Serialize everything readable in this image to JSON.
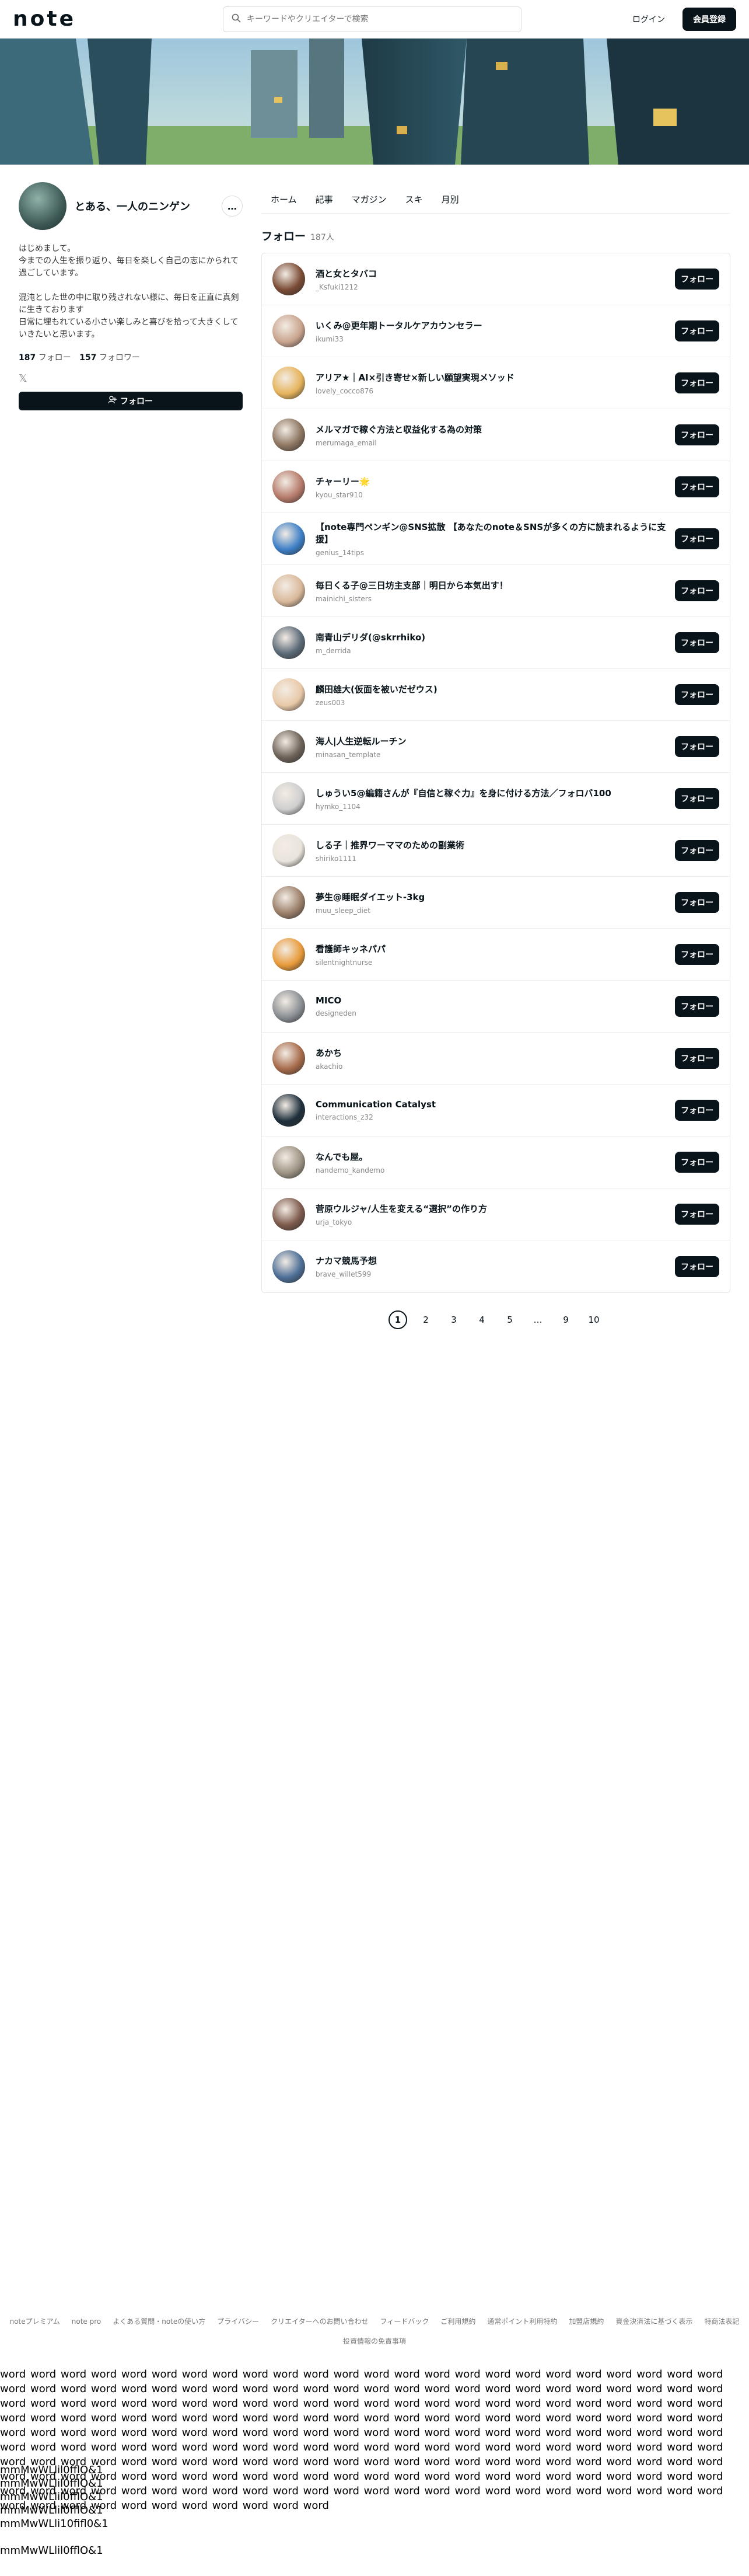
{
  "header": {
    "logo": "note",
    "search_placeholder": "キーワードやクリエイターで検索",
    "login": "ログイン",
    "signup": "会員登録"
  },
  "profile": {
    "name": "とある、一人のニンゲン",
    "more": "…",
    "bio": "はじめまして。\n今までの人生を振り返り、毎日を楽しく自己の志にかられて過ごしています。\n\n混沌とした世の中に取り残されない様に、毎日を正直に真剣に生きております\n日常に埋もれている小さい楽しみと喜びを拾って大きくしていきたいと思います。",
    "following_count": "187",
    "following_label": "フォロー",
    "followers_count": "157",
    "followers_label": "フォロワー",
    "x_icon": "x-logo-icon",
    "follow_button": "フォロー"
  },
  "tabs": [
    "ホーム",
    "記事",
    "マガジン",
    "スキ",
    "月別"
  ],
  "section": {
    "title": "フォロー",
    "count": "187人"
  },
  "follow_button_label": "フォロー",
  "users": [
    {
      "name": "酒と女とタバコ",
      "id": "_Ksfuki1212",
      "color": "#7a4b35"
    },
    {
      "name": "いくみ@更年期トータルケアカウンセラー",
      "id": "ikumi33",
      "color": "#c9a48e"
    },
    {
      "name": "アリア★｜AI×引き寄せ×新しい願望実現メソッド",
      "id": "lovely_cocco876",
      "color": "#e6b45c"
    },
    {
      "name": "メルマガで稼ぐ方法と収益化する為の対策",
      "id": "merumaga_email",
      "color": "#8c7560"
    },
    {
      "name": "チャーリー🌟",
      "id": "kyou_star910",
      "color": "#b57a6a"
    },
    {
      "name": "【note専門ペンギン@SNS拡散 【あなたのnote＆SNSが多くの方に読まれるように支援】",
      "id": "genius_14tips",
      "color": "#3d7fc6"
    },
    {
      "name": "毎日くる子@三日坊主支部｜明日から本気出す！",
      "id": "mainichi_sisters",
      "color": "#d9b99b"
    },
    {
      "name": "南青山デリダ(@skrrhiko)",
      "id": "m_derrida",
      "color": "#5b6a78"
    },
    {
      "name": "麟田雄大(仮面を被いだゼウス)",
      "id": "zeus003",
      "color": "#e8c9a8"
    },
    {
      "name": "海人|人生逆転ルーチン",
      "id": "minasan_template",
      "color": "#6d6258"
    },
    {
      "name": "しゅうい5@編籍さんが『自信と稼ぐ力』を身に付ける方法／フォロバ100",
      "id": "hymko_1104",
      "color": "#cfcfcf"
    },
    {
      "name": "しる子｜推界ワーママのための副業術",
      "id": "shiriko1111",
      "color": "#e9e4dc"
    },
    {
      "name": "夢生@睡眠ダイエット-3kg",
      "id": "muu_sleep_diet",
      "color": "#9b7f6a"
    },
    {
      "name": "看護師キッネパパ",
      "id": "silentnightnurse",
      "color": "#e89a3a"
    },
    {
      "name": "MICO",
      "id": "designeden",
      "color": "#8a8f94"
    },
    {
      "name": "あかち",
      "id": "akachio",
      "color": "#a66a4a"
    },
    {
      "name": "Communication Catalyst",
      "id": "interactions_z32",
      "color": "#1e2f3c"
    },
    {
      "name": "なんでも屋。",
      "id": "nandemo_kandemo",
      "color": "#9d9384"
    },
    {
      "name": "菅原ウルジャ/人生を変える“選択”の作り方",
      "id": "urja_tokyo",
      "color": "#7d5a4c"
    },
    {
      "name": "ナカマ競馬予想",
      "id": "brave_willet599",
      "color": "#4d6e96"
    }
  ],
  "pagination": [
    "1",
    "2",
    "3",
    "4",
    "5",
    "…",
    "9",
    "10"
  ],
  "footer": {
    "links": [
      "noteプレミアム",
      "note pro",
      "よくある質問・noteの使い方",
      "プライバシー",
      "クリエイターへのお問い合わせ",
      "フィードバック",
      "ご利用規約",
      "通常ポイント利用特約",
      "加盟店規約",
      "資金決済法に基づく表示",
      "特商法表記"
    ],
    "extra": "投資情報の免責事項"
  },
  "filler_text": "word word word word word word word word word word word word word word word word word word word word word word word word word word word word word word word word word word word word word word word word word word word word word word word word word word word word word word word word word word word word word word word word word word word word word word word word word word word word word word word word word word word word word word word word word word word word word word word word word word word word word word word word word word word word word word word word word word word word word word word word word word word word word word word word word word word word word word word word word word word word word word word word word word word word word word word word word word word word word word word word word word word word word word word word word word word word word word word word word word word word word word word word word word word word word word word word word word word word word word word word word word word word word word word word word word word word word word word word word word word word word word word word word word word",
  "mono_lines": [
    "mmMwWLlil0fflO&1",
    "mmMwWLlil0fflO&1",
    "mmMwWLlil0fflO&1",
    "mmMwWLlil0fflO&1",
    "mmMwWLli10fifl0&1",
    "",
    "mmMwWLlil0fflO&1"
  ]
}
